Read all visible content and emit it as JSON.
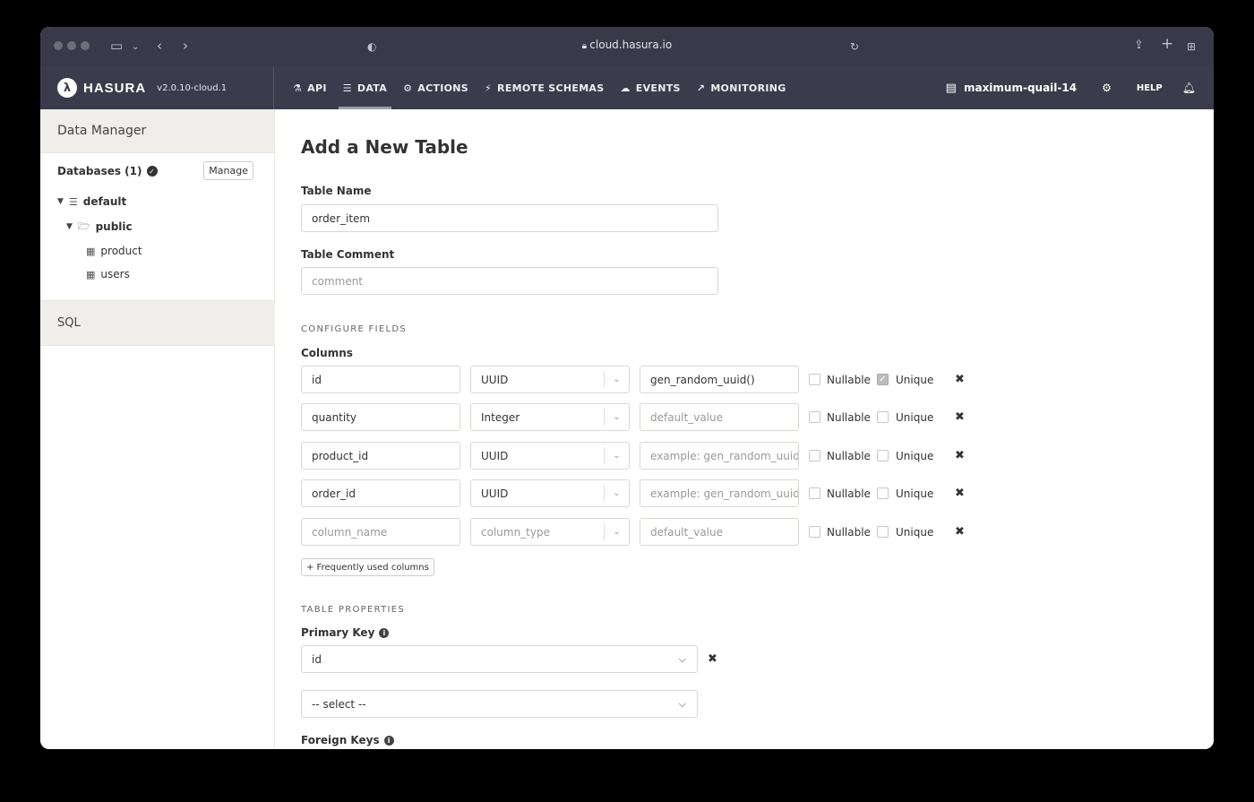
{
  "browser": {
    "url": "cloud.hasura.io",
    "icons": [
      "sidebar-icon",
      "back-icon",
      "forward-icon",
      "shield-icon",
      "reload-icon",
      "share-icon",
      "new-tab-icon",
      "tabs-overview-icon"
    ]
  },
  "navbar": {
    "brand": "HASURA",
    "version": "v2.0.10-cloud.1",
    "tabs": [
      {
        "label": "API",
        "icon": "flask-icon",
        "glyph": "⚗"
      },
      {
        "label": "DATA",
        "icon": "database-icon",
        "glyph": "☰"
      },
      {
        "label": "ACTIONS",
        "icon": "cogs-icon",
        "glyph": "⚙"
      },
      {
        "label": "REMOTE SCHEMAS",
        "icon": "plug-icon",
        "glyph": "⚡"
      },
      {
        "label": "EVENTS",
        "icon": "cloud-icon",
        "glyph": "☁"
      },
      {
        "label": "MONITORING",
        "icon": "chart-icon",
        "glyph": "↗"
      }
    ],
    "active_tab": "DATA",
    "project": "maximum-quail-14",
    "help": "HELP"
  },
  "sidebar": {
    "title": "Data Manager",
    "databases_label": "Databases (1)",
    "manage": "Manage",
    "database": "default",
    "schema": "public",
    "tables": [
      "product",
      "users"
    ],
    "sql": "SQL"
  },
  "main": {
    "title": "Add a New Table",
    "table_name_label": "Table Name",
    "table_name_value": "order_item",
    "table_comment_label": "Table Comment",
    "table_comment_placeholder": "comment",
    "configure_fields": "CONFIGURE FIELDS",
    "columns_label": "Columns",
    "nullable_label": "Nullable",
    "unique_label": "Unique",
    "columns": [
      {
        "name": "id",
        "name_placeholder": false,
        "type": "UUID",
        "type_placeholder": false,
        "default": "gen_random_uuid()",
        "default_placeholder": false,
        "nullable": false,
        "unique": true
      },
      {
        "name": "quantity",
        "name_placeholder": false,
        "type": "Integer",
        "type_placeholder": false,
        "default": "default_value",
        "default_placeholder": true,
        "nullable": false,
        "unique": false
      },
      {
        "name": "product_id",
        "name_placeholder": false,
        "type": "UUID",
        "type_placeholder": false,
        "default": "example: gen_random_uuid(",
        "default_placeholder": true,
        "nullable": false,
        "unique": false
      },
      {
        "name": "order_id",
        "name_placeholder": false,
        "type": "UUID",
        "type_placeholder": false,
        "default": "example: gen_random_uuid(",
        "default_placeholder": true,
        "nullable": false,
        "unique": false
      },
      {
        "name": "column_name",
        "name_placeholder": true,
        "type": "column_type",
        "type_placeholder": true,
        "default": "default_value",
        "default_placeholder": true,
        "nullable": false,
        "unique": false
      }
    ],
    "frequently_used": "+ Frequently used columns",
    "table_properties": "TABLE PROPERTIES",
    "primary_key_label": "Primary Key",
    "primary_key_value": "id",
    "primary_key_select": "-- select --",
    "foreign_keys_label": "Foreign Keys"
  }
}
